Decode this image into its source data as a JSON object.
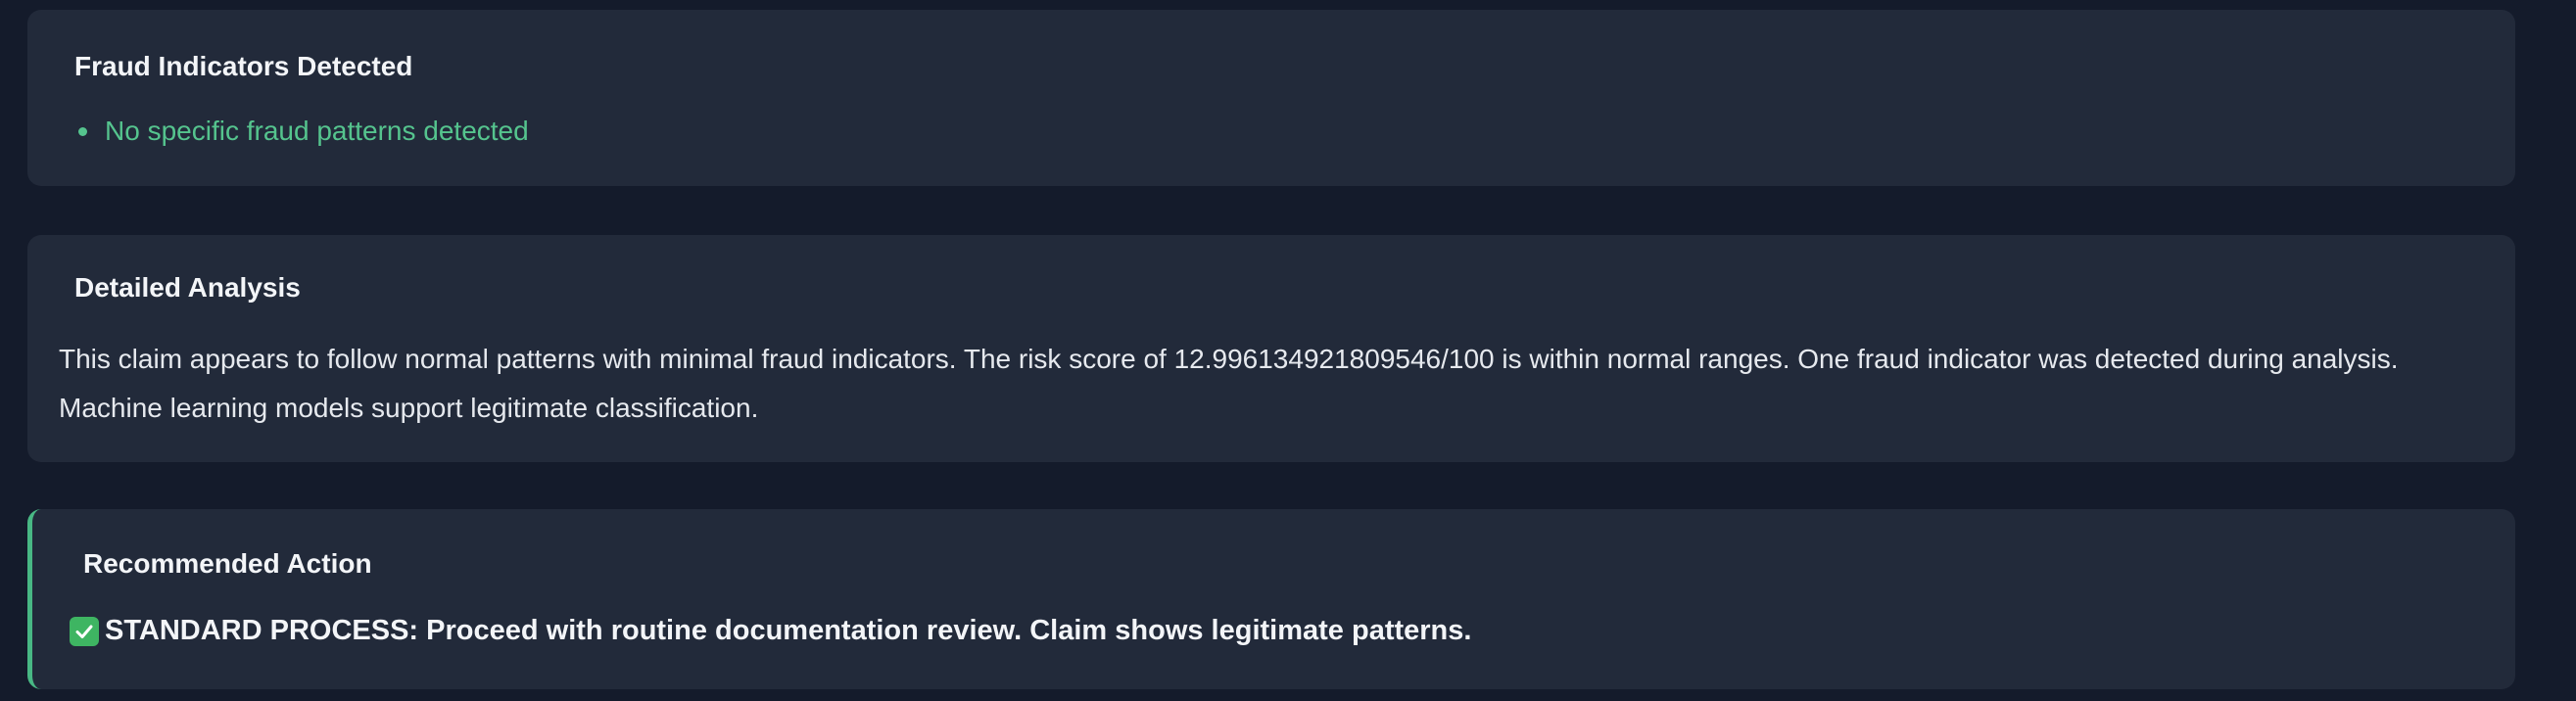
{
  "fraud_indicators": {
    "title": "Fraud Indicators Detected",
    "items": [
      "No specific fraud patterns detected"
    ],
    "item_color": "#55c48e"
  },
  "detailed_analysis": {
    "title": "Detailed Analysis",
    "text": "This claim appears to follow normal patterns with minimal fraud indicators. The risk score of 12.996134921809546/100 is within normal ranges. One fraud indicator was detected during analysis. Machine learning models support legitimate classification."
  },
  "recommended_action": {
    "title": "Recommended Action",
    "icon": "check-box-icon",
    "text": "STANDARD PROCESS: Proceed with routine documentation review. Claim shows legitimate patterns.",
    "accent_color": "#48b884"
  },
  "colors": {
    "background": "#141b2b",
    "card": "#222a3a",
    "text": "#e6e9ee"
  }
}
